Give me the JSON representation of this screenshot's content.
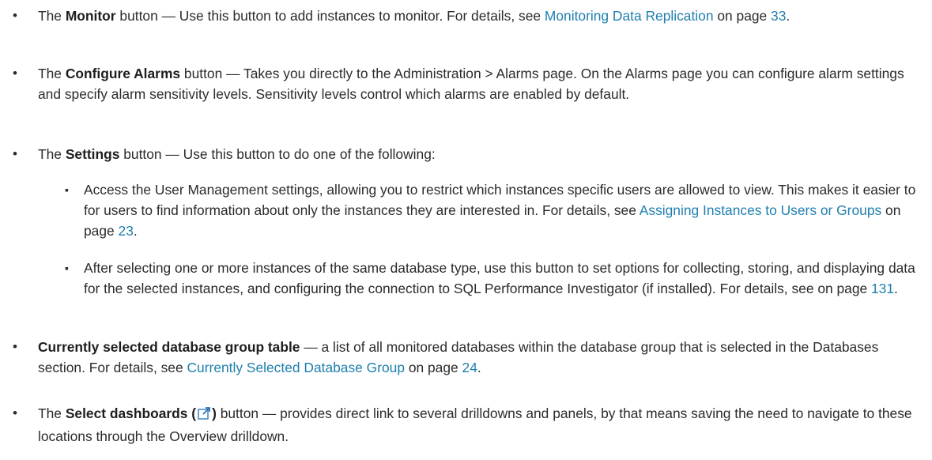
{
  "items": [
    {
      "prefix": "The ",
      "bold": "Monitor",
      "text1": " button — Use this button to add instances to monitor. For details, see ",
      "link1": "Monitoring Data Replication",
      "text2": " on page ",
      "page_link": "33",
      "suffix": "."
    },
    {
      "prefix": "The ",
      "bold": "Configure Alarms",
      "text1": " button — Takes you directly to the Administration > Alarms page. On the Alarms page you can configure alarm settings and specify alarm sensitivity levels. Sensitivity levels control which alarms are enabled by default."
    },
    {
      "prefix": "The ",
      "bold": "Settings",
      "text1": " button — Use this button to do one of the following:",
      "subitems": [
        {
          "text1": "Access the User Management settings, allowing you to restrict which instances specific users are allowed to view. This makes it easier to for users to find information about only the instances they are interested in. For details, see ",
          "link1": "Assigning Instances to Users or Groups",
          "text2": " on page ",
          "page_link": "23",
          "suffix": "."
        },
        {
          "text1": "After selecting one or more instances of the same database type, use this button to set options for collecting, storing, and displaying data for the selected instances, and configuring the connection to SQL Performance Investigator (if installed). For details, see  on page ",
          "page_link": "131",
          "suffix": "."
        }
      ]
    },
    {
      "bold": "Currently selected database group table",
      "text1": " — a list of all monitored databases within the database group that is selected in the Databases section. For details, see ",
      "link1": "Currently Selected Database Group",
      "text2": " on page ",
      "page_link": "24",
      "suffix": "."
    },
    {
      "prefix": "The ",
      "bold": "Select dashboards (",
      "bold_close": ")",
      "text1": " button — provides direct link to several drilldowns and panels, by that means saving the need to navigate to these locations through the Overview drilldown.",
      "icon": "external-link-icon"
    }
  ],
  "bullet_main": "•",
  "bullet_sub": "▪",
  "colors": {
    "text": "#2b2b2b",
    "link": "#1f7fae",
    "icon": "#4a8cc7"
  }
}
